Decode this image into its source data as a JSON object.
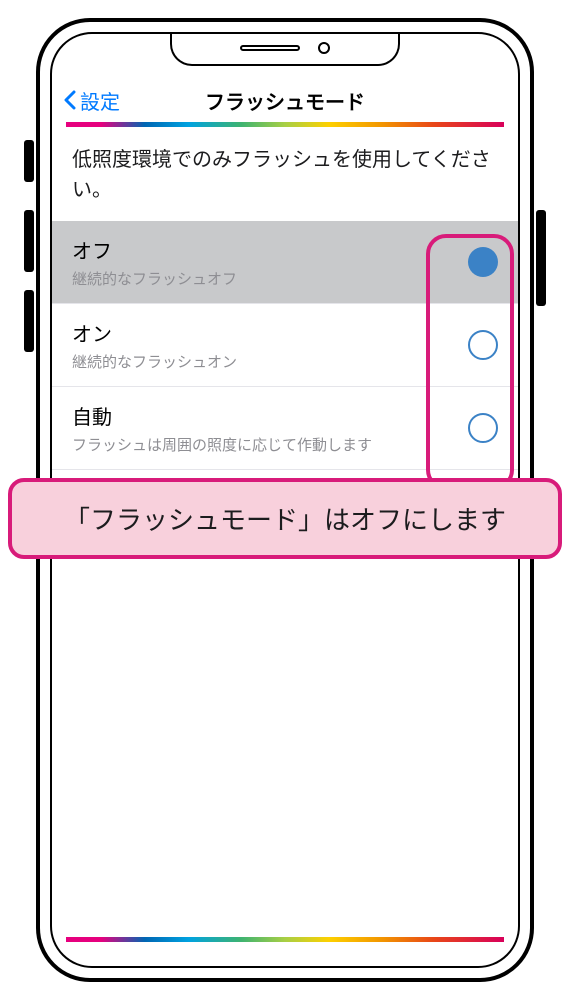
{
  "nav": {
    "back_label": "設定",
    "title": "フラッシュモード"
  },
  "section_header": "低照度環境でのみフラッシュを使用してください。",
  "options": [
    {
      "title": "オフ",
      "sub": "継続的なフラッシュオフ",
      "selected": true
    },
    {
      "title": "オン",
      "sub": "継続的なフラッシュオン",
      "selected": false
    },
    {
      "title": "自動",
      "sub": "フラッシュは周囲の照度に応じて作動します",
      "selected": false
    }
  ],
  "callout": "「フラッシュモード」はオフにします"
}
